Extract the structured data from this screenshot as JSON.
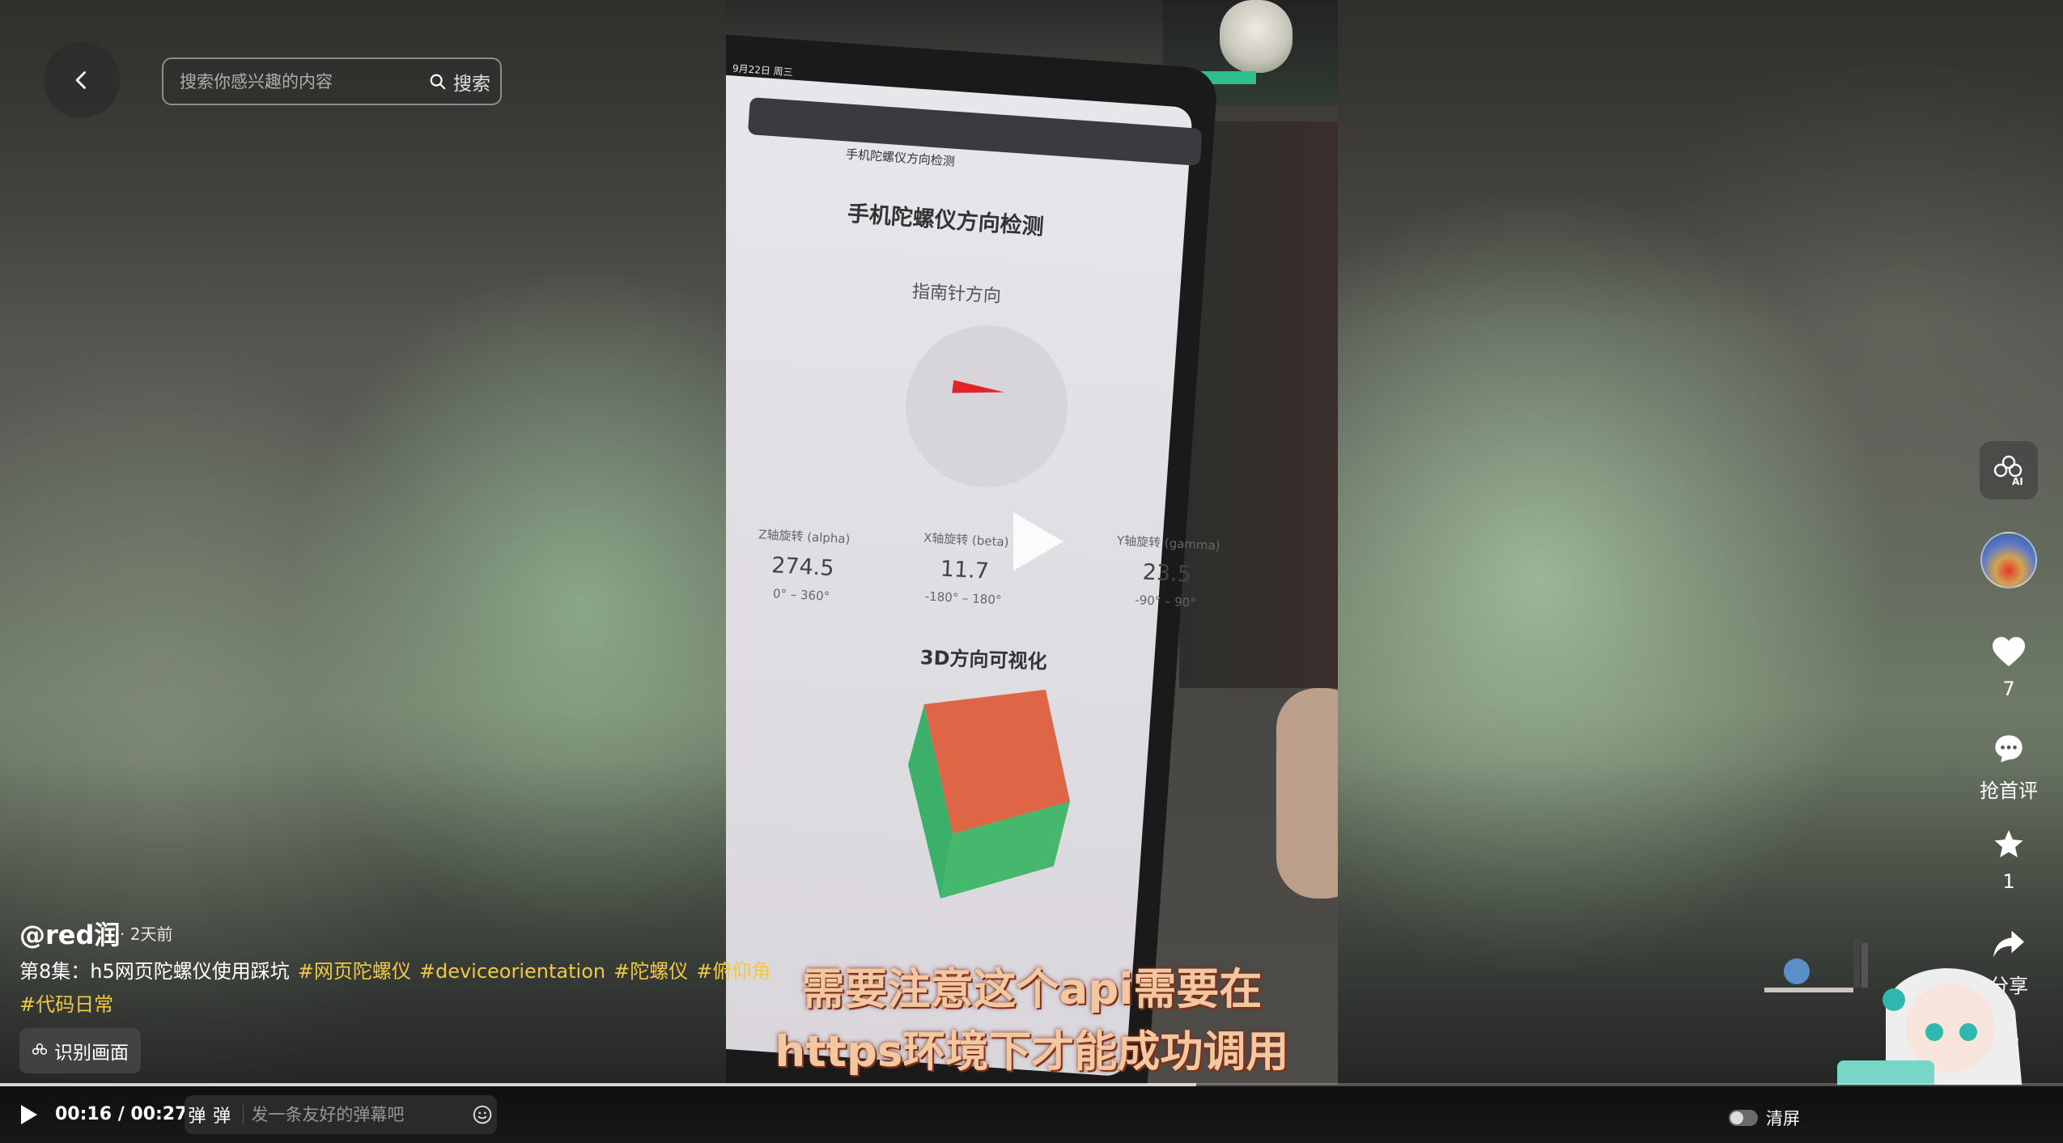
{
  "search": {
    "placeholder": "搜索你感兴趣的内容",
    "button_label": "搜索"
  },
  "video": {
    "screen": {
      "status": "9月22日 周三",
      "tab_title": "手机陀螺仪方向检测",
      "heading": "手机陀螺仪方向检测",
      "compass_label": "指南针方向",
      "axes": [
        {
          "label": "Z轴旋转 (alpha)",
          "value": "274.5",
          "range": "0° – 360°"
        },
        {
          "label": "X轴旋转 (beta)",
          "value": "11.7",
          "range": "-180° – 180°"
        },
        {
          "label": "Y轴旋转 (gamma)",
          "value": "23.5",
          "range": "-90° – 90°"
        }
      ],
      "visual_label": "3D方向可视化"
    },
    "subtitle_line1": "需要注意这个api需要在",
    "subtitle_line2": "https环境下才能成功调用",
    "progress": 0.58
  },
  "post": {
    "author": "@red润",
    "time": "· 2天前",
    "episode_title": "第8集：h5网页陀螺仪使用踩坑",
    "tags": [
      "#网页陀螺仪",
      "#deviceorientation",
      "#陀螺仪",
      "#俯仰角",
      "#代码日常"
    ],
    "recognize_label": "识别画面"
  },
  "actions": {
    "like_count": "7",
    "comment_label": "抢首评",
    "favorite_count": "1",
    "share_label": "分享",
    "more": "···"
  },
  "controls": {
    "time": "00:16 / 00:27",
    "danmaku_icon1": "弹",
    "danmaku_icon2": "弹",
    "danmaku_placeholder": "发一条友好的弹幕吧",
    "clear_label": "清屏"
  },
  "colors": {
    "tag": "#f2c744",
    "subtitle": "#f3c8a0",
    "needle": "#e0242a"
  }
}
